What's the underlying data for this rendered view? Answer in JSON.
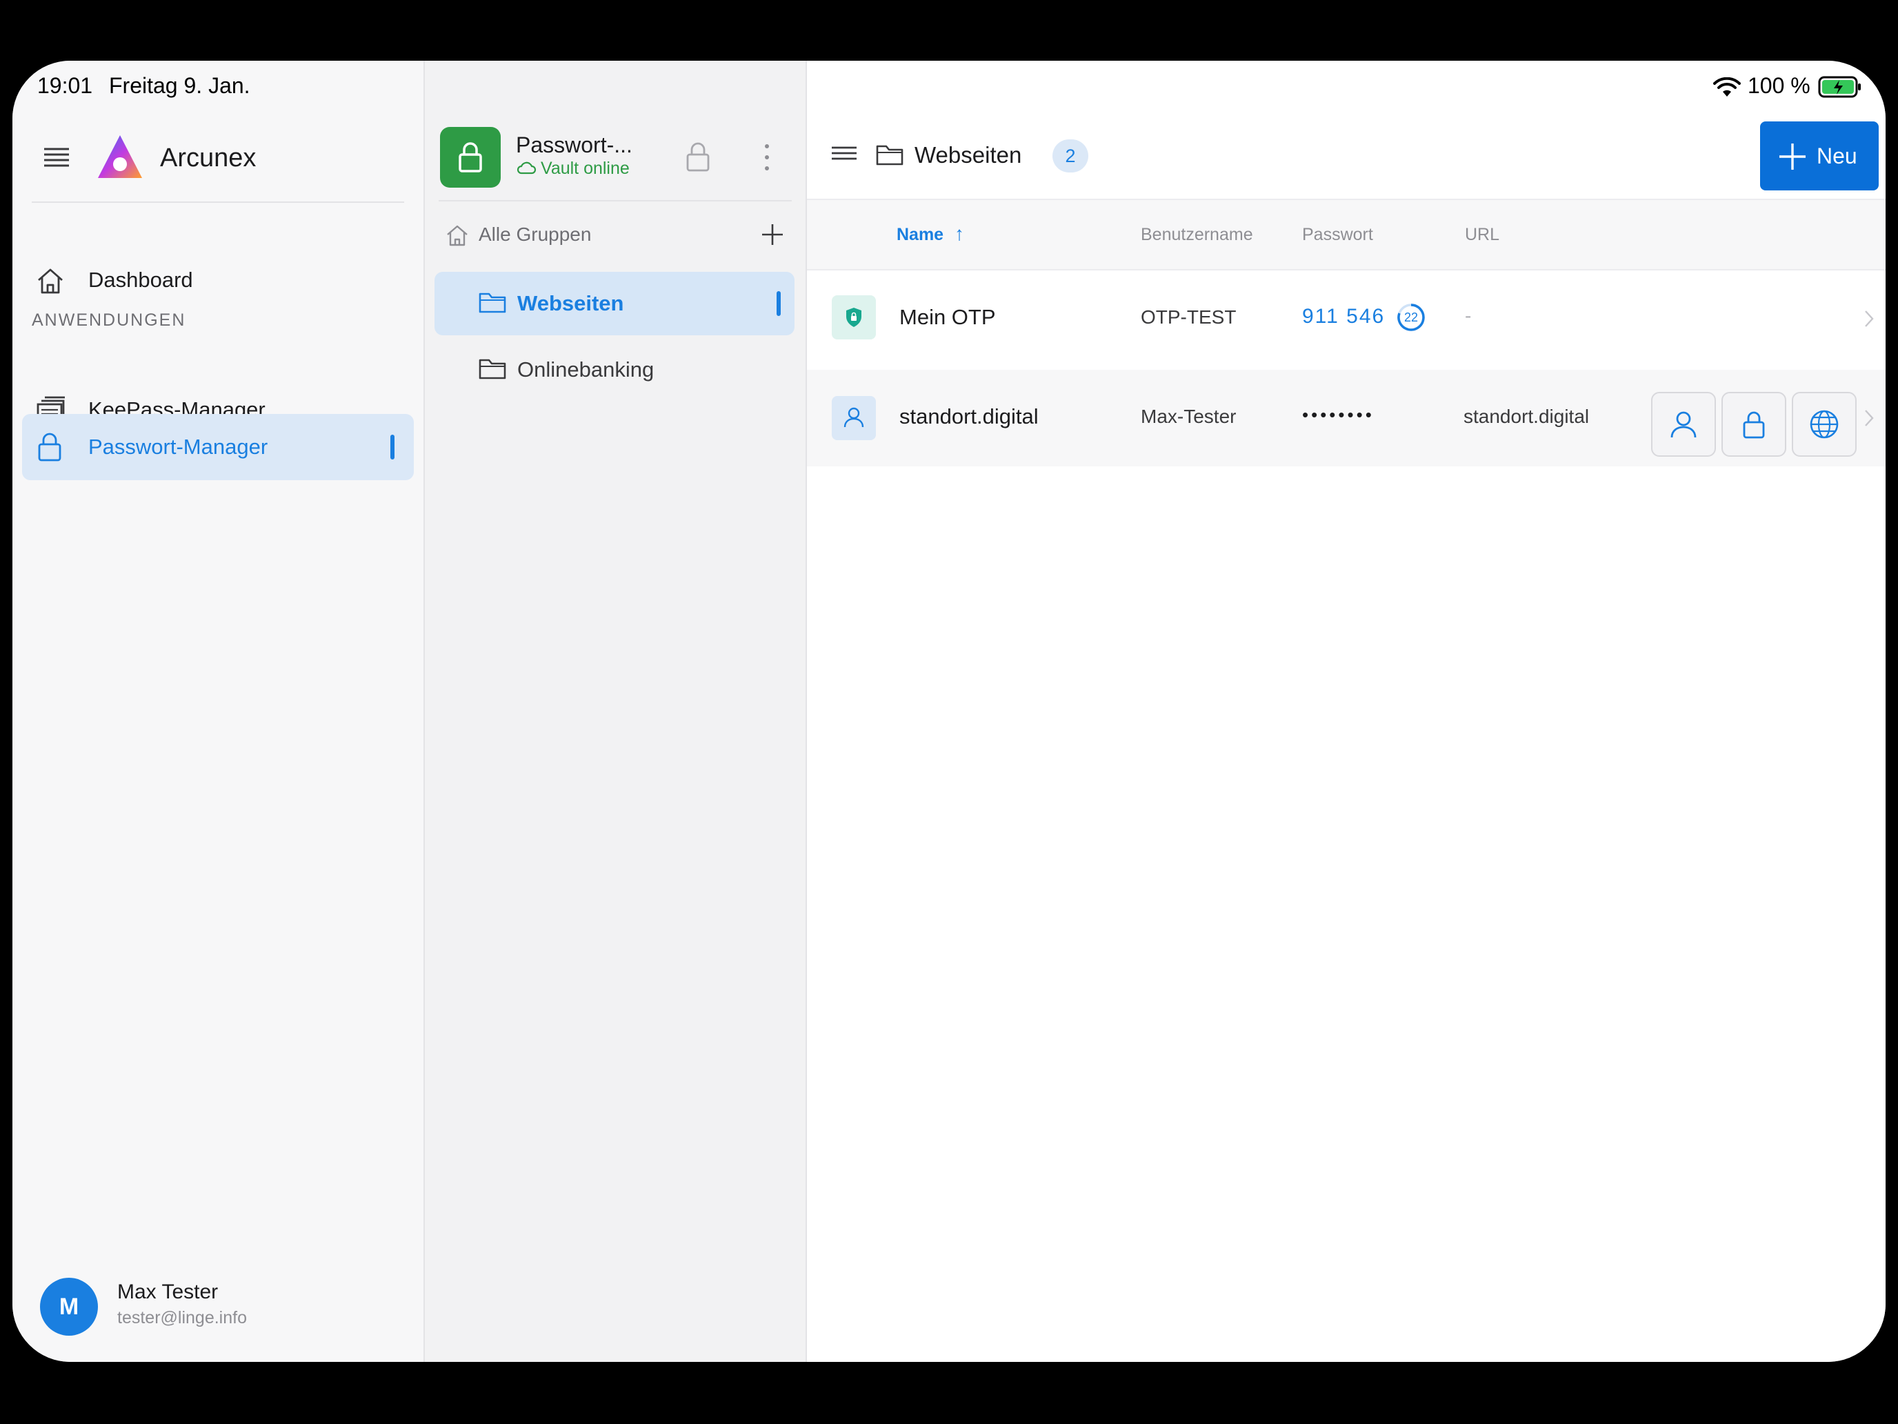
{
  "status_bar": {
    "time": "19:01",
    "date": "Freitag 9. Jan.",
    "battery": "100 %"
  },
  "app": {
    "name": "Arcunex"
  },
  "nav": {
    "dashboard": "Dashboard",
    "section_label": "ANWENDUNGEN",
    "keepass": "KeePass-Manager",
    "password_manager": "Passwort-Manager"
  },
  "user": {
    "initial": "M",
    "name": "Max Tester",
    "email": "tester@linge.info"
  },
  "vault": {
    "title": "Passwort-...",
    "status": "Vault online"
  },
  "groups": {
    "all_label": "Alle Gruppen",
    "items": [
      "Webseiten",
      "Onlinebanking"
    ]
  },
  "header": {
    "folder": "Webseiten",
    "count": "2",
    "new_label": "Neu"
  },
  "table": {
    "columns": {
      "name": "Name",
      "username": "Benutzername",
      "password": "Passwort",
      "url": "URL"
    },
    "sort_indicator": "↑",
    "rows": [
      {
        "name": "Mein OTP",
        "username": "OTP-TEST",
        "password": "911 546",
        "otp_seconds": "22",
        "url": "-"
      },
      {
        "name": "standort.digital",
        "username": "Max-Tester",
        "password": "••••••••",
        "url": "standort.digital"
      }
    ]
  },
  "colors": {
    "accent": "#1a7fe0",
    "vault_green": "#2e9b45",
    "otp_teal": "#18a88f"
  }
}
